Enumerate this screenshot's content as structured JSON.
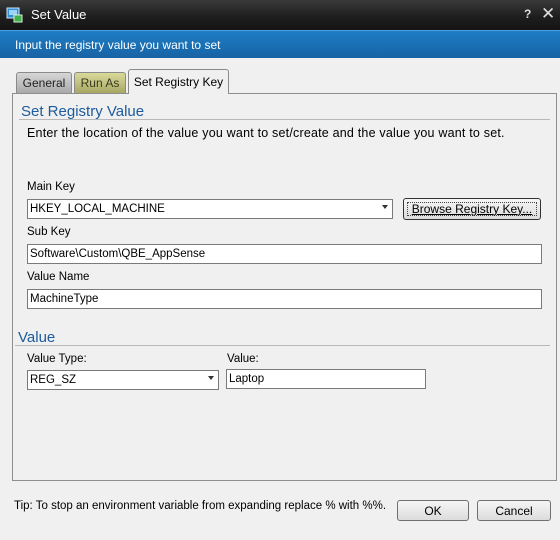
{
  "window": {
    "title": "Set Value",
    "help": "?",
    "close": "✕"
  },
  "banner": {
    "text": "Input the registry value you want to set"
  },
  "tabs": [
    {
      "label": "General"
    },
    {
      "label": "Run As"
    },
    {
      "label": "Set Registry Key"
    }
  ],
  "registry_section": {
    "title": "Set Registry Value",
    "instruction": "Enter the location of the value you want to set/create and the value you want to set.",
    "main_key": {
      "label": "Main Key",
      "value": "HKEY_LOCAL_MACHINE"
    },
    "browse_button": "Browse Registry Key...",
    "sub_key": {
      "label": "Sub Key",
      "value": "Software\\Custom\\QBE_AppSense"
    },
    "value_name": {
      "label": "Value Name",
      "value": "MachineType"
    }
  },
  "value_section": {
    "title": "Value",
    "value_type": {
      "label": "Value Type:",
      "value": "REG_SZ"
    },
    "value": {
      "label": "Value:",
      "value": "Laptop"
    }
  },
  "footer": {
    "tip": "Tip: To stop an environment variable from expanding replace % with %%.",
    "ok": "OK",
    "cancel": "Cancel"
  },
  "colors": {
    "banner": "#1a6fb5",
    "section_title": "#1c5b9c",
    "titlebar": "#1e1e1e"
  }
}
